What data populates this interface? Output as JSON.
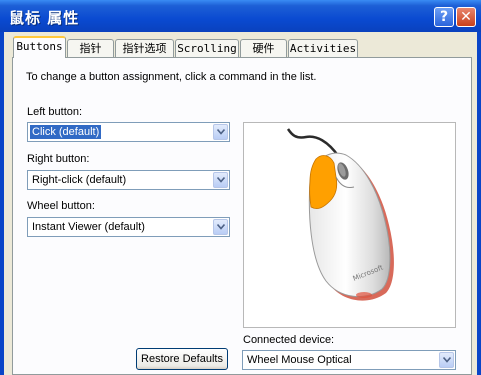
{
  "window": {
    "title": "鼠标 属性",
    "help_glyph": "?",
    "close_glyph": "✕"
  },
  "tabs": [
    {
      "label": "Buttons",
      "active": true
    },
    {
      "label": "指针"
    },
    {
      "label": "指针选项"
    },
    {
      "label": "Scrolling"
    },
    {
      "label": "硬件"
    },
    {
      "label": "Activities"
    }
  ],
  "buttons_page": {
    "instruction": "To change a button assignment, click a command in the list.",
    "left_button": {
      "label": "Left button:",
      "value": "Click (default)"
    },
    "right_button": {
      "label": "Right button:",
      "value": "Right-click (default)"
    },
    "wheel_button": {
      "label": "Wheel button:",
      "value": "Instant Viewer (default)"
    },
    "restore_defaults": "Restore Defaults",
    "connected_device": {
      "label": "Connected device:",
      "value": "Wheel Mouse Optical"
    },
    "mouse_logo_text": "Microsoft"
  },
  "colors": {
    "titlebar": "#0a4ad1",
    "highlight": "#316ac5",
    "button_highlight": "#ffa000",
    "active_tab_accent": "#ffc83c"
  }
}
